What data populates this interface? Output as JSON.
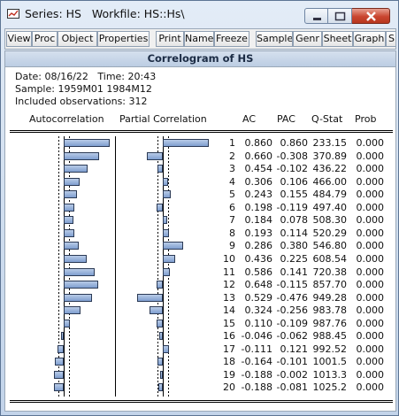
{
  "window": {
    "title": "Series: HS   Workfile: HS::Hs\\"
  },
  "toolbar": {
    "buttons": [
      "View",
      "Proc",
      "Object",
      "Properties",
      "Print",
      "Name",
      "Freeze",
      "Sample",
      "Genr",
      "Sheet",
      "Graph",
      "S"
    ]
  },
  "view": {
    "header": "Correlogram of HS",
    "date_line": "Date: 08/16/22   Time: 20:43",
    "sample_line": "Sample: 1959M01 1984M12",
    "obs_line": "Included observations: 312",
    "col_autocorr": "Autocorrelation",
    "col_partial": "Partial Correlation",
    "col_ac": "AC",
    "col_pac": "PAC",
    "col_qstat": "Q-Stat",
    "col_prob": "Prob",
    "rows": [
      {
        "lag": "1",
        "ac": "0.860",
        "pac": "0.860",
        "q": "233.15",
        "prob": "0.000"
      },
      {
        "lag": "2",
        "ac": "0.660",
        "pac": "-0.308",
        "q": "370.89",
        "prob": "0.000"
      },
      {
        "lag": "3",
        "ac": "0.454",
        "pac": "-0.102",
        "q": "436.22",
        "prob": "0.000"
      },
      {
        "lag": "4",
        "ac": "0.306",
        "pac": "0.106",
        "q": "466.00",
        "prob": "0.000"
      },
      {
        "lag": "5",
        "ac": "0.243",
        "pac": "0.155",
        "q": "484.79",
        "prob": "0.000"
      },
      {
        "lag": "6",
        "ac": "0.198",
        "pac": "-0.119",
        "q": "497.40",
        "prob": "0.000"
      },
      {
        "lag": "7",
        "ac": "0.184",
        "pac": "0.078",
        "q": "508.30",
        "prob": "0.000"
      },
      {
        "lag": "8",
        "ac": "0.193",
        "pac": "0.114",
        "q": "520.29",
        "prob": "0.000"
      },
      {
        "lag": "9",
        "ac": "0.286",
        "pac": "0.380",
        "q": "546.80",
        "prob": "0.000"
      },
      {
        "lag": "10",
        "ac": "0.436",
        "pac": "0.225",
        "q": "608.54",
        "prob": "0.000"
      },
      {
        "lag": "11",
        "ac": "0.586",
        "pac": "0.141",
        "q": "720.38",
        "prob": "0.000"
      },
      {
        "lag": "12",
        "ac": "0.648",
        "pac": "-0.115",
        "q": "857.70",
        "prob": "0.000"
      },
      {
        "lag": "13",
        "ac": "0.529",
        "pac": "-0.476",
        "q": "949.28",
        "prob": "0.000"
      },
      {
        "lag": "14",
        "ac": "0.324",
        "pac": "-0.256",
        "q": "983.78",
        "prob": "0.000"
      },
      {
        "lag": "15",
        "ac": "0.110",
        "pac": "-0.109",
        "q": "987.76",
        "prob": "0.000"
      },
      {
        "lag": "16",
        "ac": "-0.046",
        "pac": "-0.062",
        "q": "988.45",
        "prob": "0.000"
      },
      {
        "lag": "17",
        "ac": "-0.111",
        "pac": "0.121",
        "q": "992.52",
        "prob": "0.000"
      },
      {
        "lag": "18",
        "ac": "-0.164",
        "pac": "-0.101",
        "q": "1001.5",
        "prob": "0.000"
      },
      {
        "lag": "19",
        "ac": "-0.188",
        "pac": "-0.002",
        "q": "1013.3",
        "prob": "0.000"
      },
      {
        "lag": "20",
        "ac": "-0.188",
        "pac": "-0.081",
        "q": "1025.2",
        "prob": "0.000"
      }
    ]
  }
}
